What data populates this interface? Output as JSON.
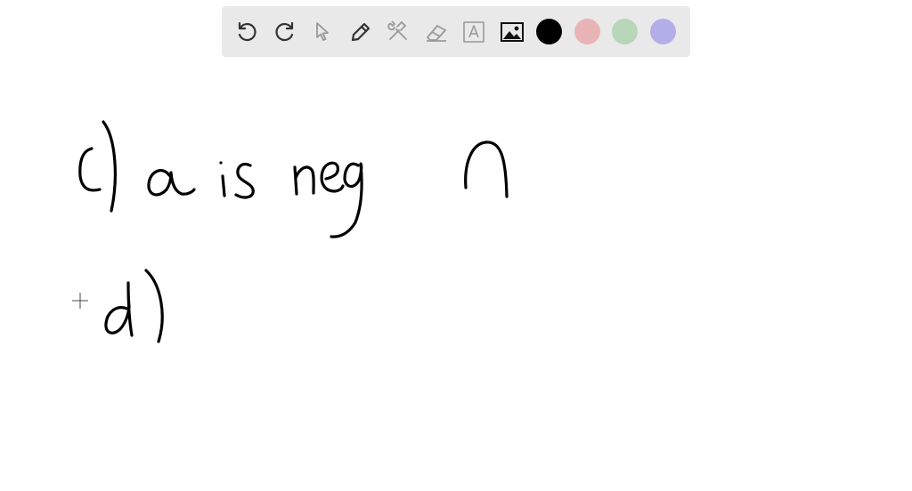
{
  "toolbar": {
    "tools": [
      {
        "name": "undo-button",
        "icon": "undo-icon"
      },
      {
        "name": "redo-button",
        "icon": "redo-icon"
      },
      {
        "name": "select-tool-button",
        "icon": "pointer-icon"
      },
      {
        "name": "pen-tool-button",
        "icon": "pencil-icon"
      },
      {
        "name": "tools-button",
        "icon": "wrench-hammer-icon"
      },
      {
        "name": "eraser-tool-button",
        "icon": "eraser-icon"
      },
      {
        "name": "text-tool-button",
        "icon": "text-box-icon"
      },
      {
        "name": "image-tool-button",
        "icon": "image-icon"
      }
    ],
    "colors": [
      "#000000",
      "#e8b4b6",
      "#b8d6b8",
      "#b3aee8"
    ]
  }
}
